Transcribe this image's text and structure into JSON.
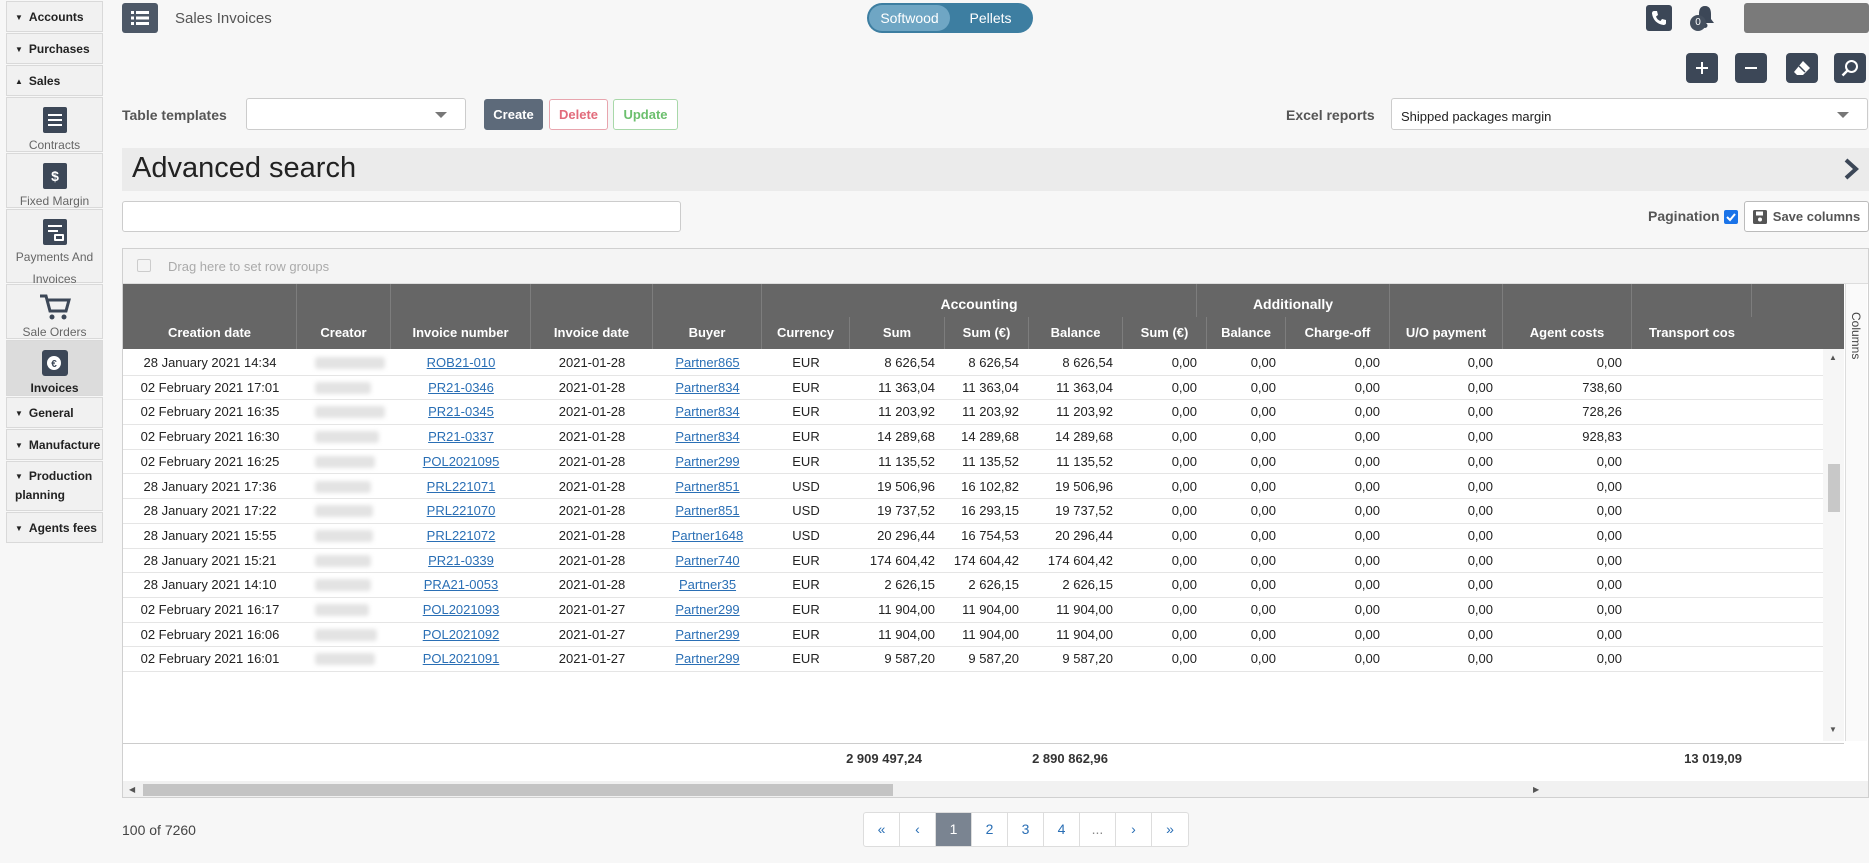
{
  "sidebar": {
    "sections_top": [
      {
        "label": "Accounts",
        "arrow": "▼"
      },
      {
        "label": "Purchases",
        "arrow": "▼"
      },
      {
        "label": "Sales",
        "arrow": "▲"
      }
    ],
    "modules": [
      {
        "label": "Contracts",
        "icon": "document-icon"
      },
      {
        "label": "Fixed Margin",
        "icon": "dollar-document-icon"
      },
      {
        "label": "Payments And Invoices",
        "icon": "payments-icon"
      },
      {
        "label": "Sale Orders",
        "icon": "cart-icon"
      },
      {
        "label": "Invoices",
        "icon": "invoice-euro-icon"
      }
    ],
    "sections_bottom": [
      {
        "label": "General",
        "arrow": "▼"
      },
      {
        "label": "Manufacture",
        "arrow": "▼"
      },
      {
        "label": "Production planning",
        "arrow": "▼"
      },
      {
        "label": "Agents fees",
        "arrow": "▼"
      }
    ]
  },
  "header": {
    "title": "Sales Invoices",
    "toggle": {
      "left": "Softwood",
      "right": "Pellets"
    },
    "notification_count": "0"
  },
  "templates": {
    "label": "Table templates",
    "selected": "",
    "create": "Create",
    "delete": "Delete",
    "update": "Update"
  },
  "excel": {
    "label": "Excel reports",
    "selected": "Shipped packages margin"
  },
  "advanced_search": {
    "title": "Advanced search",
    "search_value": ""
  },
  "pagination_label": "Pagination",
  "save_columns": "Save columns",
  "group_hint": "Drag here to set row groups",
  "columns_tab": "Columns",
  "group_headers": {
    "accounting": "Accounting",
    "additionally": "Additionally"
  },
  "columns": [
    "Creation date",
    "Creator",
    "Invoice number",
    "Invoice date",
    "Buyer",
    "Currency",
    "Sum",
    "Sum (€)",
    "Balance",
    "Sum (€)",
    "Balance",
    "Charge-off",
    "U/O payment",
    "Agent costs",
    "Transport cos"
  ],
  "rows": [
    [
      "28 January 2021 14:34",
      "ROB21-010",
      "2021-01-28",
      "Partner865",
      "EUR",
      "8 626,54",
      "8 626,54",
      "8 626,54",
      "0,00",
      "0,00",
      "0,00",
      "0,00",
      "0,00"
    ],
    [
      "02 February 2021 17:01",
      "PR21-0346",
      "2021-01-28",
      "Partner834",
      "EUR",
      "11 363,04",
      "11 363,04",
      "11 363,04",
      "0,00",
      "0,00",
      "0,00",
      "0,00",
      "738,60"
    ],
    [
      "02 February 2021 16:35",
      "PR21-0345",
      "2021-01-28",
      "Partner834",
      "EUR",
      "11 203,92",
      "11 203,92",
      "11 203,92",
      "0,00",
      "0,00",
      "0,00",
      "0,00",
      "728,26"
    ],
    [
      "02 February 2021 16:30",
      "PR21-0337",
      "2021-01-28",
      "Partner834",
      "EUR",
      "14 289,68",
      "14 289,68",
      "14 289,68",
      "0,00",
      "0,00",
      "0,00",
      "0,00",
      "928,83"
    ],
    [
      "02 February 2021 16:25",
      "POL2021095",
      "2021-01-28",
      "Partner299",
      "EUR",
      "11 135,52",
      "11 135,52",
      "11 135,52",
      "0,00",
      "0,00",
      "0,00",
      "0,00",
      "0,00"
    ],
    [
      "28 January 2021 17:36",
      "PRL221071",
      "2021-01-28",
      "Partner851",
      "USD",
      "19 506,96",
      "16 102,82",
      "19 506,96",
      "0,00",
      "0,00",
      "0,00",
      "0,00",
      "0,00"
    ],
    [
      "28 January 2021 17:22",
      "PRL221070",
      "2021-01-28",
      "Partner851",
      "USD",
      "19 737,52",
      "16 293,15",
      "19 737,52",
      "0,00",
      "0,00",
      "0,00",
      "0,00",
      "0,00"
    ],
    [
      "28 January 2021 15:55",
      "PRL221072",
      "2021-01-28",
      "Partner1648",
      "USD",
      "20 296,44",
      "16 754,53",
      "20 296,44",
      "0,00",
      "0,00",
      "0,00",
      "0,00",
      "0,00"
    ],
    [
      "28 January 2021 15:21",
      "PR21-0339",
      "2021-01-28",
      "Partner740",
      "EUR",
      "174 604,42",
      "174 604,42",
      "174 604,42",
      "0,00",
      "0,00",
      "0,00",
      "0,00",
      "0,00"
    ],
    [
      "28 January 2021 14:10",
      "PRA21-0053",
      "2021-01-28",
      "Partner35",
      "EUR",
      "2 626,15",
      "2 626,15",
      "2 626,15",
      "0,00",
      "0,00",
      "0,00",
      "0,00",
      "0,00"
    ],
    [
      "02 February 2021 16:17",
      "POL2021093",
      "2021-01-27",
      "Partner299",
      "EUR",
      "11 904,00",
      "11 904,00",
      "11 904,00",
      "0,00",
      "0,00",
      "0,00",
      "0,00",
      "0,00"
    ],
    [
      "02 February 2021 16:06",
      "POL2021092",
      "2021-01-27",
      "Partner299",
      "EUR",
      "11 904,00",
      "11 904,00",
      "11 904,00",
      "0,00",
      "0,00",
      "0,00",
      "0,00",
      "0,00"
    ],
    [
      "02 February 2021 16:01",
      "POL2021091",
      "2021-01-27",
      "Partner299",
      "EUR",
      "9 587,20",
      "9 587,20",
      "9 587,20",
      "0,00",
      "0,00",
      "0,00",
      "0,00",
      "0,00"
    ]
  ],
  "totals": {
    "sum": "2 909 497,24",
    "balance": "2 890 862,96",
    "agent_costs": "13 019,09"
  },
  "record_count": "100 of 7260",
  "pager": [
    "«",
    "‹",
    "1",
    "2",
    "3",
    "4",
    "...",
    "›",
    "»"
  ],
  "pager_current": "1",
  "colors": {
    "accent": "#3d7ea1",
    "header_bg": "#666666",
    "dark_button": "#3c4757",
    "link": "#2a6fb5"
  }
}
